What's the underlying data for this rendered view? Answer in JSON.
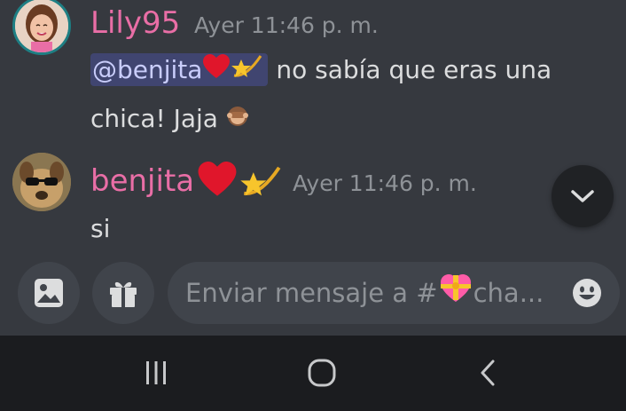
{
  "messages": [
    {
      "author": "Lily95",
      "author_color": "#e96ea6",
      "timestamp": "Ayer 11:46 p. m.",
      "mention": "@benjita",
      "text_line1": "no sabía que eras una",
      "text_line2": "chica! Jaja",
      "text_emoji": "see-no-evil-monkey-icon"
    },
    {
      "author": "benjita",
      "author_color": "#e96ea6",
      "author_emojis": [
        "red-heart-icon",
        "dizzy-star-icon"
      ],
      "timestamp": "Ayer 11:46 p. m.",
      "text_line1": "si"
    }
  ],
  "composer": {
    "placeholder_prefix": "Enviar mensaje a #",
    "placeholder_suffix": "cha..."
  },
  "colors": {
    "background": "#36393f",
    "input": "#40444b",
    "navbar": "#1b1c1f",
    "mention_text": "#c9cdfb"
  }
}
